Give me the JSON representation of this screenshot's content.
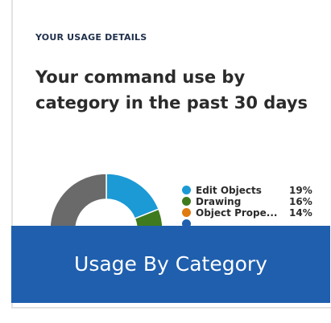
{
  "card": {
    "eyebrow": "YOUR USAGE DETAILS",
    "headline": "Your command use by category in the past 30 days"
  },
  "legend": [
    {
      "label": "Edit Objects",
      "percent": "19%",
      "color": "#1b9ad6"
    },
    {
      "label": "Drawing",
      "percent": "16%",
      "color": "#3f7b1e"
    },
    {
      "label": "Object Prope...",
      "percent": "14%",
      "color": "#e07b10"
    },
    {
      "label": "",
      "percent": "",
      "color": "#1f5fae"
    }
  ],
  "donut_colors": {
    "edit_objects": "#1b9ad6",
    "drawing": "#3f7b1e",
    "rest": "#6a6a6a"
  },
  "banner": {
    "title": "Usage By Category",
    "color": "#1f5fae"
  }
}
